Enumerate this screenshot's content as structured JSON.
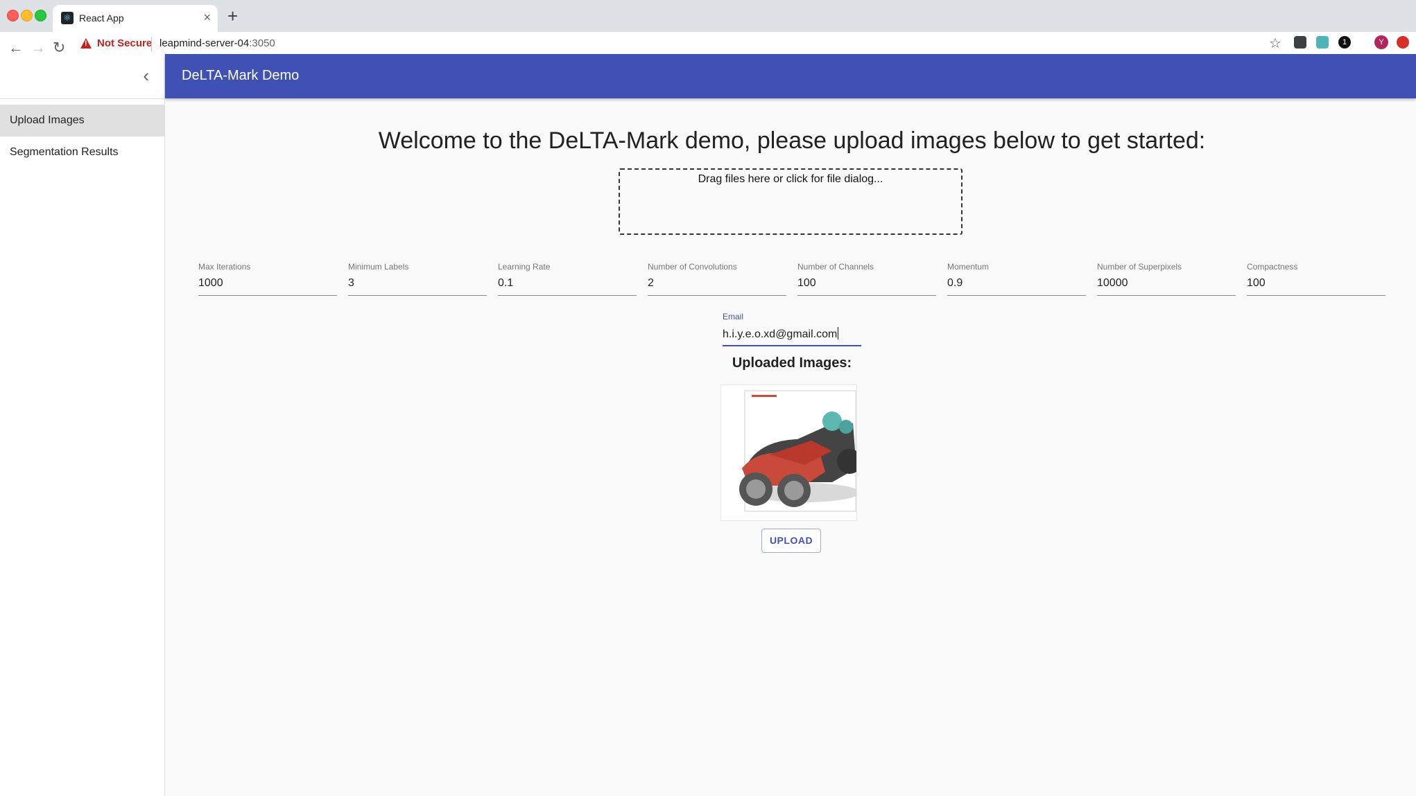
{
  "browser": {
    "tab_title": "React App",
    "tab_close": "×",
    "new_tab": "+",
    "security_label": "Not Secure",
    "url_host": "leapmind-server-04",
    "url_port": ":3050",
    "avatar_initial": "Y",
    "ext_badge": "1"
  },
  "sidebar": {
    "items": [
      {
        "label": "Upload Images"
      },
      {
        "label": "Segmentation Results"
      }
    ]
  },
  "appbar": {
    "title": "DeLTA-Mark Demo"
  },
  "main": {
    "welcome": "Welcome to the DeLTA-Mark demo, please upload images below to get started:",
    "dropzone_text": "Drag files here or click for file dialog...",
    "params": [
      {
        "label": "Max Iterations",
        "value": "1000"
      },
      {
        "label": "Minimum Labels",
        "value": "3"
      },
      {
        "label": "Learning Rate",
        "value": "0.1"
      },
      {
        "label": "Number of Convolutions",
        "value": "2"
      },
      {
        "label": "Number of Channels",
        "value": "100"
      },
      {
        "label": "Momentum",
        "value": "0.9"
      },
      {
        "label": "Number of Superpixels",
        "value": "10000"
      },
      {
        "label": "Compactness",
        "value": "100"
      }
    ],
    "email": {
      "label": "Email",
      "value": "h.i.y.e.o.xd@gmail.com"
    },
    "uploaded_heading": "Uploaded Images:",
    "upload_button": "UPLOAD"
  },
  "colors": {
    "appbar": "#3f51b5",
    "accent": "#3f51b5",
    "warning": "#c5221f"
  },
  "icons": [
    "back-icon",
    "forward-icon",
    "reload-icon",
    "warning-icon",
    "star-icon",
    "chevron-left-icon",
    "react-favicon-icon"
  ]
}
